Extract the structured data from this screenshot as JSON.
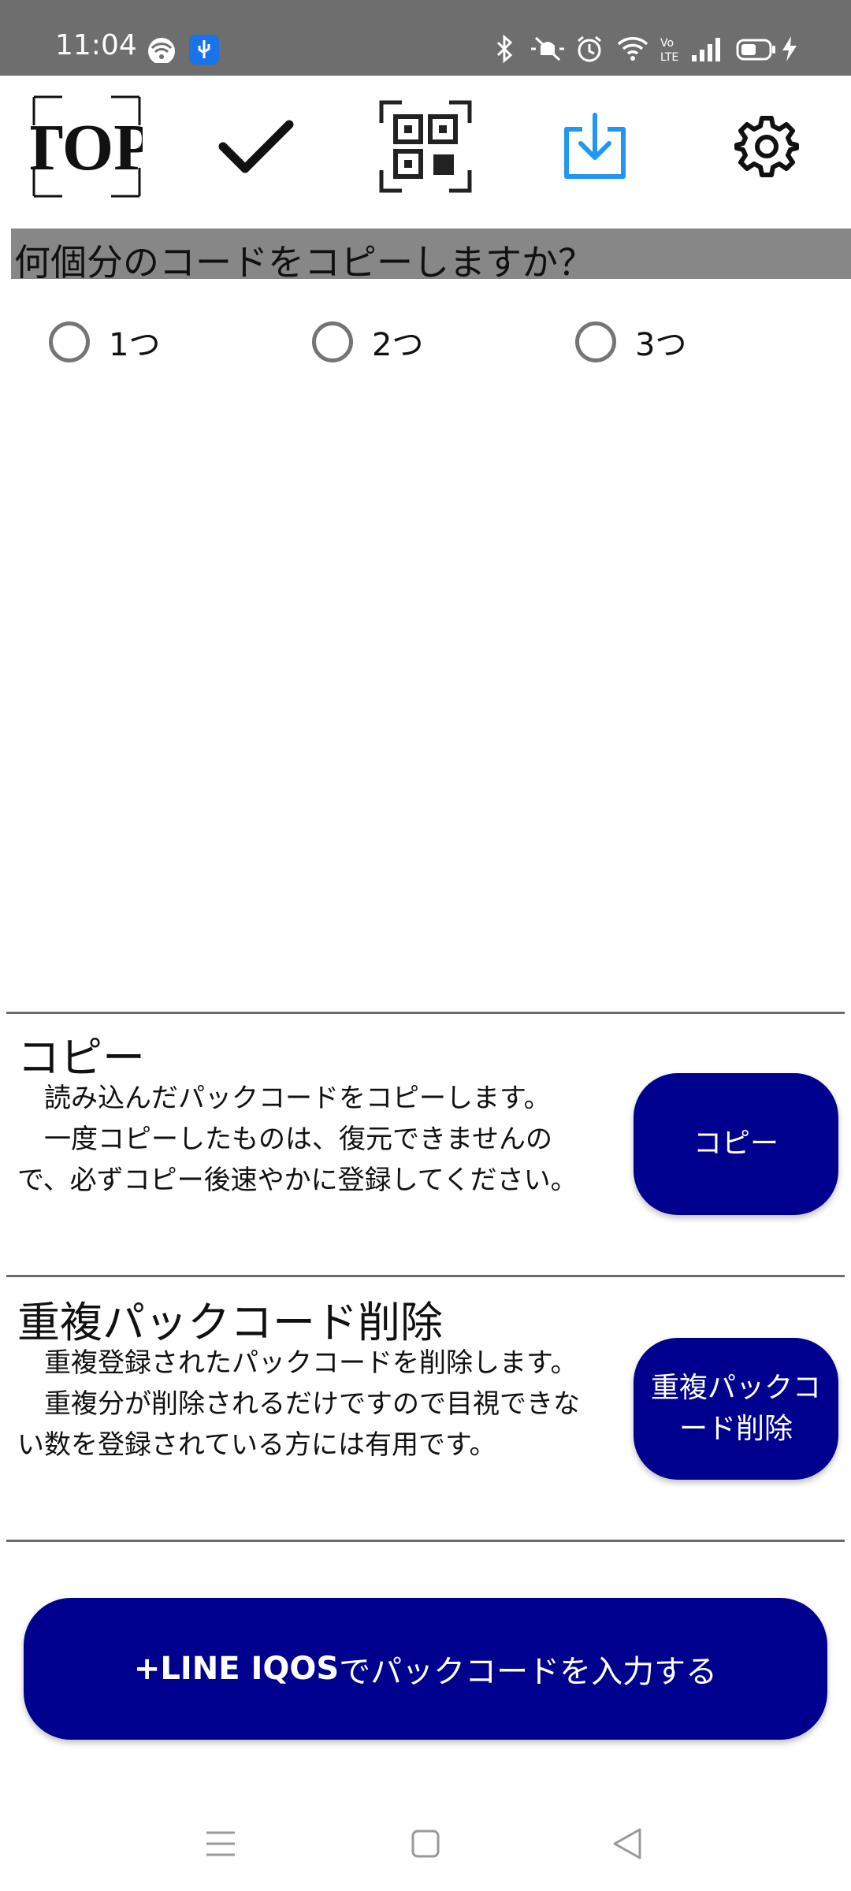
{
  "status_bar": {
    "time": "11:04",
    "icons": [
      "wifi-icon",
      "usb-icon",
      "bluetooth-icon",
      "mute-icon",
      "alarm-icon",
      "wifi-signal-icon",
      "volte-icon",
      "cell-signal-icon",
      "battery-icon",
      "charging-icon"
    ],
    "usb_badge_color": "#1a73e8"
  },
  "toolbar": {
    "top_label": "TOP",
    "items": [
      "top-icon",
      "check-icon",
      "qr-code-icon",
      "download-icon",
      "gear-icon"
    ],
    "download_color": "#2196f3"
  },
  "question": {
    "text": "何個分のコードをコピーしますか？",
    "options": [
      "1つ",
      "2つ",
      "3つ"
    ]
  },
  "copy_section": {
    "title": "コピー",
    "desc_lines": [
      "　読み込んだパックコードをコピーします。",
      "　一度コピーしたものは、復元できませんの",
      "で、必ずコピー後速やかに登録してください。"
    ],
    "button_label": "コピー"
  },
  "dedupe_section": {
    "title": "重複パックコード削除",
    "desc_lines": [
      "　重複登録されたパックコードを削除します。",
      "　重複分が削除されるだけですので目視できな",
      "い数を登録されている方には有用です。"
    ],
    "button_lines": [
      "重複パックコ",
      "ード削除"
    ]
  },
  "line_button": {
    "prefix": "+LINE IQOS",
    "suffix": "でパックコードを入力する"
  },
  "nav_bar": {
    "items": [
      "menu-icon",
      "home-icon",
      "back-icon"
    ]
  },
  "colors": {
    "button_navy": "#00008f",
    "header_gray": "#878787",
    "status_bar_gray": "#6e6e6e"
  }
}
